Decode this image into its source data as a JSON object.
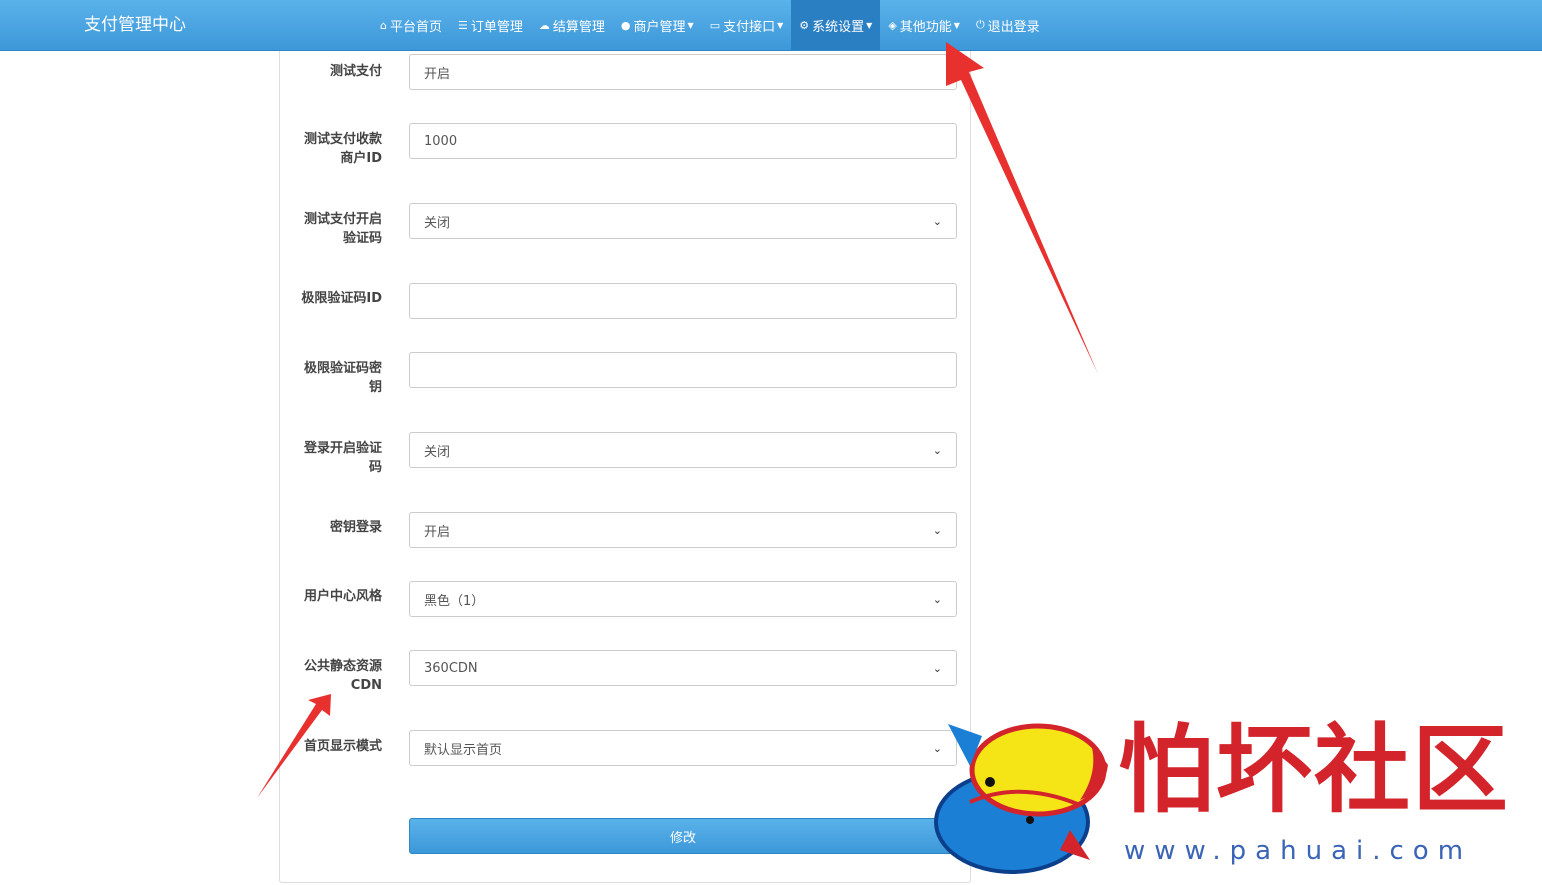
{
  "header": {
    "brand": "支付管理中心",
    "nav": [
      {
        "icon": "home-icon",
        "glyph": "🏠",
        "label": "平台首页",
        "caret": false
      },
      {
        "icon": "list-icon",
        "glyph": "☰",
        "label": "订单管理",
        "caret": false
      },
      {
        "icon": "cloud-icon",
        "glyph": "☁",
        "label": "结算管理",
        "caret": false
      },
      {
        "icon": "user-icon",
        "glyph": "👤",
        "label": "商户管理",
        "caret": true
      },
      {
        "icon": "credit-card-icon",
        "glyph": "▭",
        "label": "支付接口",
        "caret": true
      },
      {
        "icon": "gear-icon",
        "glyph": "⚙",
        "label": "系统设置",
        "caret": true,
        "active": true
      },
      {
        "icon": "cube-icon",
        "glyph": "◈",
        "label": "其他功能",
        "caret": true
      },
      {
        "icon": "power-icon",
        "glyph": "⏻",
        "label": "退出登录",
        "caret": false
      }
    ]
  },
  "form": {
    "fields": [
      {
        "label_l1": "测试支付",
        "label_l2": "",
        "value": "开启",
        "type": "input"
      },
      {
        "label_l1": "测试支付收款",
        "label_l2": "商户ID",
        "value": "1000",
        "type": "input"
      },
      {
        "label_l1": "测试支付开启",
        "label_l2": "验证码",
        "value": "关闭",
        "type": "select"
      },
      {
        "label_l1": "极限验证码ID",
        "label_l2": "",
        "value": "",
        "type": "input"
      },
      {
        "label_l1": "极限验证码密",
        "label_l2": "钥",
        "value": "",
        "type": "input"
      },
      {
        "label_l1": "登录开启验证",
        "label_l2": "码",
        "value": "关闭",
        "type": "select"
      },
      {
        "label_l1": "密钥登录",
        "label_l2": "",
        "value": "开启",
        "type": "select"
      },
      {
        "label_l1": "用户中心风格",
        "label_l2": "",
        "value": "黑色（1）",
        "type": "select"
      },
      {
        "label_l1": "公共静态资源",
        "label_l2": "CDN",
        "value": "360CDN",
        "type": "select"
      },
      {
        "label_l1": "首页显示模式",
        "label_l2": "",
        "value": "默认显示首页",
        "type": "select"
      }
    ],
    "submit_label": "修改"
  },
  "watermark": {
    "title": "怕坏社区",
    "url": "www.pahuai.com"
  },
  "colors": {
    "navbar": "#3d98d9",
    "active_nav": "#2a7fc3",
    "arrow": "#e8312f",
    "watermark_red": "#d3242c",
    "watermark_blue": "#3a64b5"
  }
}
